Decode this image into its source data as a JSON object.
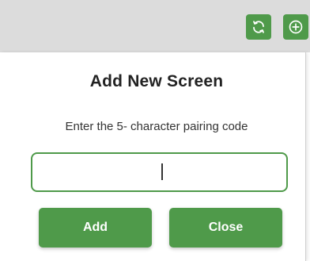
{
  "toolbar": {
    "refresh_icon": "refresh-icon",
    "add_icon": "plus-circle-icon"
  },
  "dialog": {
    "title": "Add New Screen",
    "instruction": "Enter the 5- character pairing code",
    "code_value": "",
    "add_label": "Add",
    "close_label": "Close"
  },
  "colors": {
    "accent": "#4f9a4a",
    "topbar": "#dcdcdc",
    "text": "#222222"
  }
}
